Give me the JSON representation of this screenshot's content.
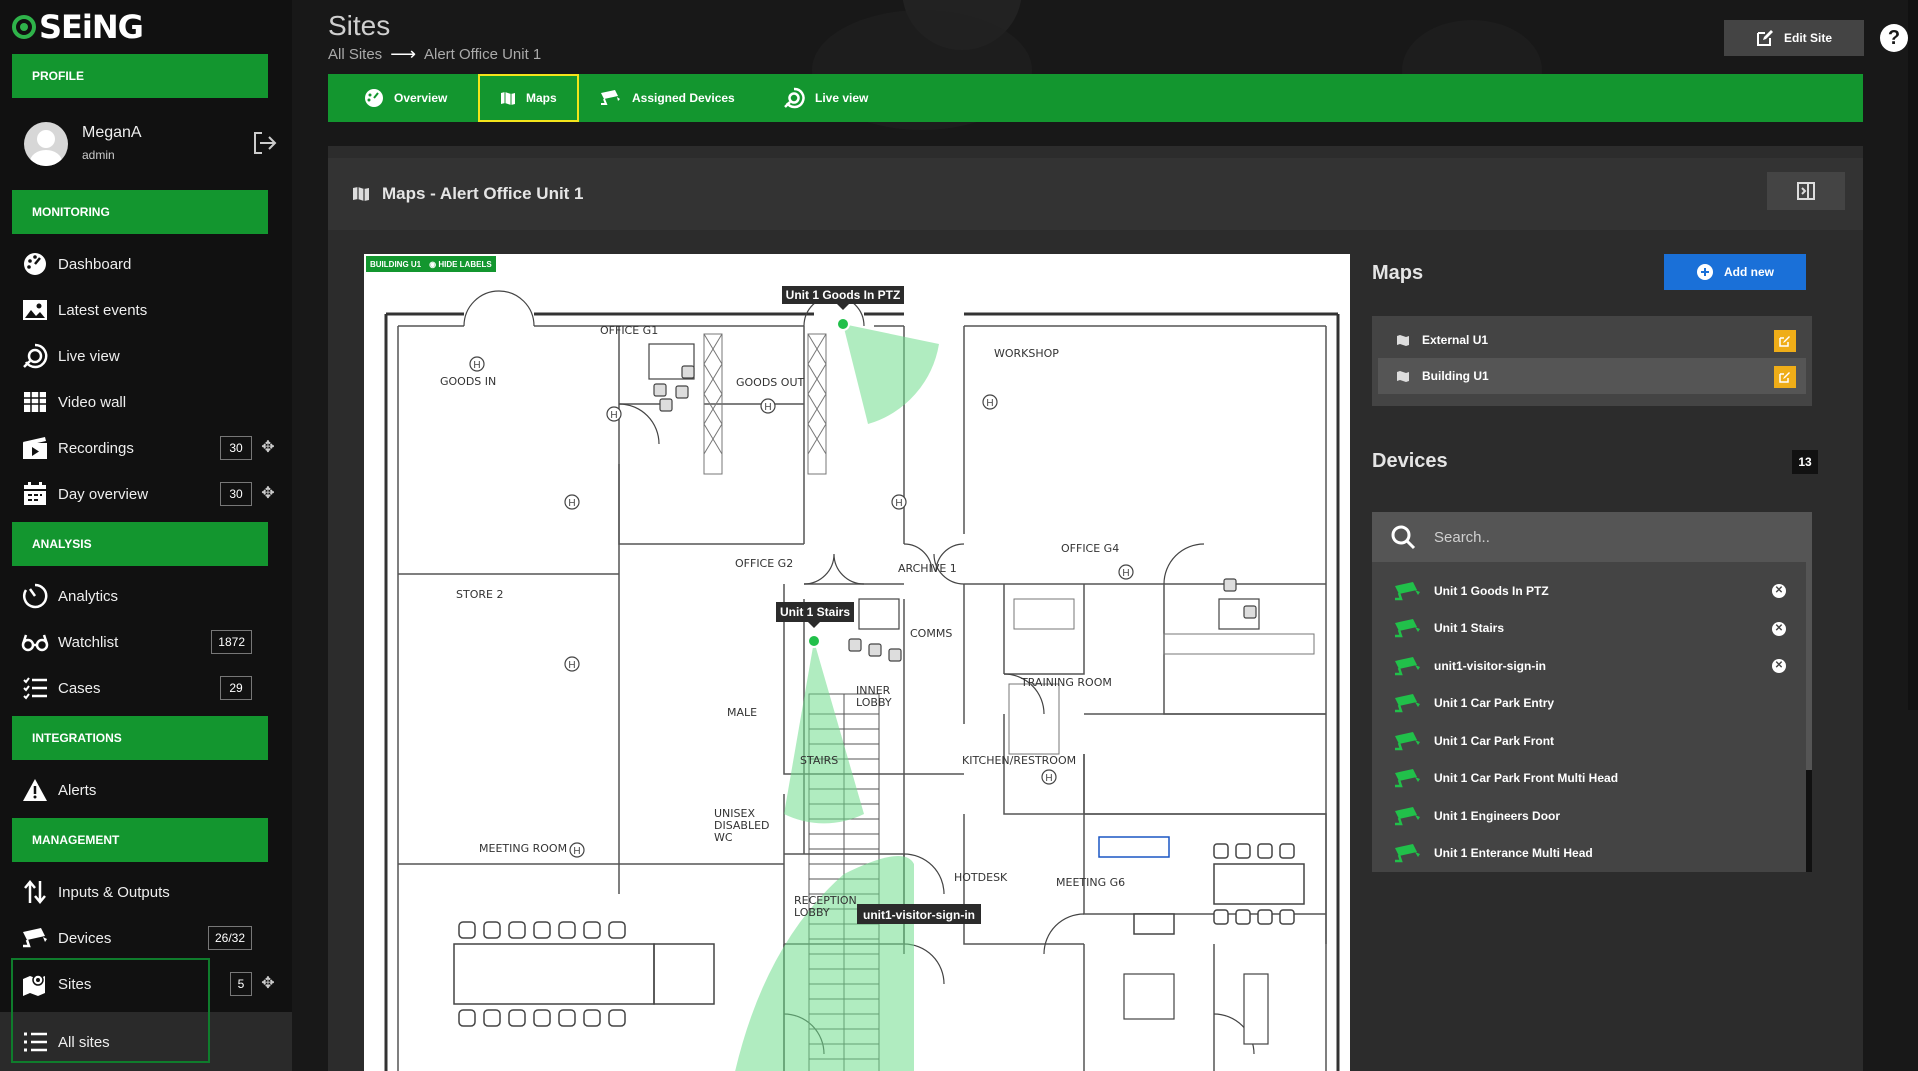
{
  "app": {
    "logo_text": "SEiNG"
  },
  "sidebar": {
    "profile_section": "PROFILE",
    "user_name": "MeganA",
    "user_role": "admin",
    "sections": {
      "monitoring": "MONITORING",
      "analysis": "ANALYSIS",
      "integrations": "INTEGRATIONS",
      "management": "MANAGEMENT"
    },
    "items": {
      "dashboard": "Dashboard",
      "latest_events": "Latest events",
      "live_view": "Live view",
      "video_wall": "Video wall",
      "recordings": "Recordings",
      "recordings_count": "30",
      "day_overview": "Day overview",
      "day_overview_count": "30",
      "analytics": "Analytics",
      "watchlist": "Watchlist",
      "watchlist_count": "1872",
      "cases": "Cases",
      "cases_count": "29",
      "alerts": "Alerts",
      "inputs_outputs": "Inputs & Outputs",
      "devices": "Devices",
      "devices_count": "26/32",
      "sites": "Sites",
      "sites_count": "5",
      "all_sites": "All sites"
    }
  },
  "header": {
    "title": "Sites",
    "breadcrumb_root": "All Sites",
    "breadcrumb_current": "Alert Office Unit 1",
    "edit_site": "Edit Site",
    "help": "?"
  },
  "tabs": {
    "overview": "Overview",
    "maps": "Maps",
    "assigned_devices": "Assigned Devices",
    "live_view": "Live view"
  },
  "panel": {
    "title": "Maps - Alert Office Unit 1"
  },
  "map": {
    "tag_building": "BUILDING U1",
    "tag_hide_labels": "HIDE LABELS",
    "rooms": {
      "office_g1": "OFFICE G1",
      "goods_in": "GOODS IN",
      "goods_out": "GOODS OUT",
      "workshop": "WORKSHOP",
      "store2": "STORE 2",
      "office_g2": "OFFICE G2",
      "archive1": "ARCHIVE 1",
      "office_g4": "OFFICE G4",
      "comms": "COMMS",
      "training_room": "TRAINING ROOM",
      "male": "MALE",
      "inner_lobby_1": "INNER",
      "inner_lobby_2": "LOBBY",
      "stairs": "STAIRS",
      "kitchen": "KITCHEN/RESTROOM",
      "unisex_1": "UNISEX",
      "unisex_2": "DISABLED",
      "unisex_3": "WC",
      "meeting_room": "MEETING ROOM",
      "hotdesk": "HOTDESK",
      "meeting_g6": "MEETING G6",
      "reception_1": "RECEPTION",
      "reception_2": "LOBBY"
    },
    "camera_labels": {
      "goods_in_ptz": "Unit 1 Goods In PTZ",
      "stairs": "Unit 1 Stairs",
      "visitor": "unit1-visitor-sign-in"
    },
    "colors": {
      "fov": "#6fdc8c",
      "camera": "#21c04a"
    }
  },
  "maps_panel": {
    "title": "Maps",
    "add_new": "Add new",
    "items": [
      {
        "label": "External U1"
      },
      {
        "label": "Building U1"
      }
    ]
  },
  "devices_panel": {
    "title": "Devices",
    "count": "13",
    "search_placeholder": "Search..",
    "items": [
      {
        "label": "Unit 1 Goods In PTZ"
      },
      {
        "label": "Unit 1 Stairs"
      },
      {
        "label": "unit1-visitor-sign-in"
      },
      {
        "label": "Unit 1 Car Park Entry"
      },
      {
        "label": "Unit 1 Car Park Front"
      },
      {
        "label": "Unit 1 Car Park Front Multi Head"
      },
      {
        "label": "Unit 1 Engineers Door"
      },
      {
        "label": "Unit 1 Enterance Multi Head"
      }
    ]
  },
  "colors": {
    "brand_green": "#13962f",
    "accent_blue": "#1a70d8",
    "edit_yellow": "#efad18",
    "highlight_yellow": "#f3e41b"
  }
}
